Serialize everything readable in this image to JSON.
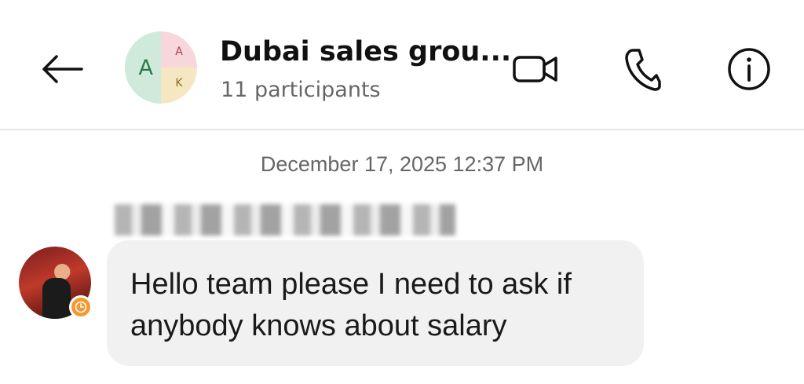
{
  "header": {
    "group_name": "Dubai sales grou...",
    "participants": "11 participants",
    "avatar_letters": {
      "main": "A",
      "top": "A",
      "bottom": "K"
    },
    "icons": {
      "back": "arrow-left-icon",
      "video": "video-camera-icon",
      "phone": "phone-icon",
      "info": "info-icon"
    }
  },
  "chat": {
    "timestamp": "December 17, 2025 12:37 PM",
    "messages": [
      {
        "text": "Hello team please I need to ask if\nanybody knows about salary",
        "sender_status": "clock-icon"
      }
    ]
  },
  "colors": {
    "bubble_bg": "#f1f1f1",
    "status_badge": "#f29a2e",
    "avatar_green": "#cfeadb",
    "avatar_pink": "#f7d6dc",
    "avatar_yellow": "#f6e7c3"
  }
}
